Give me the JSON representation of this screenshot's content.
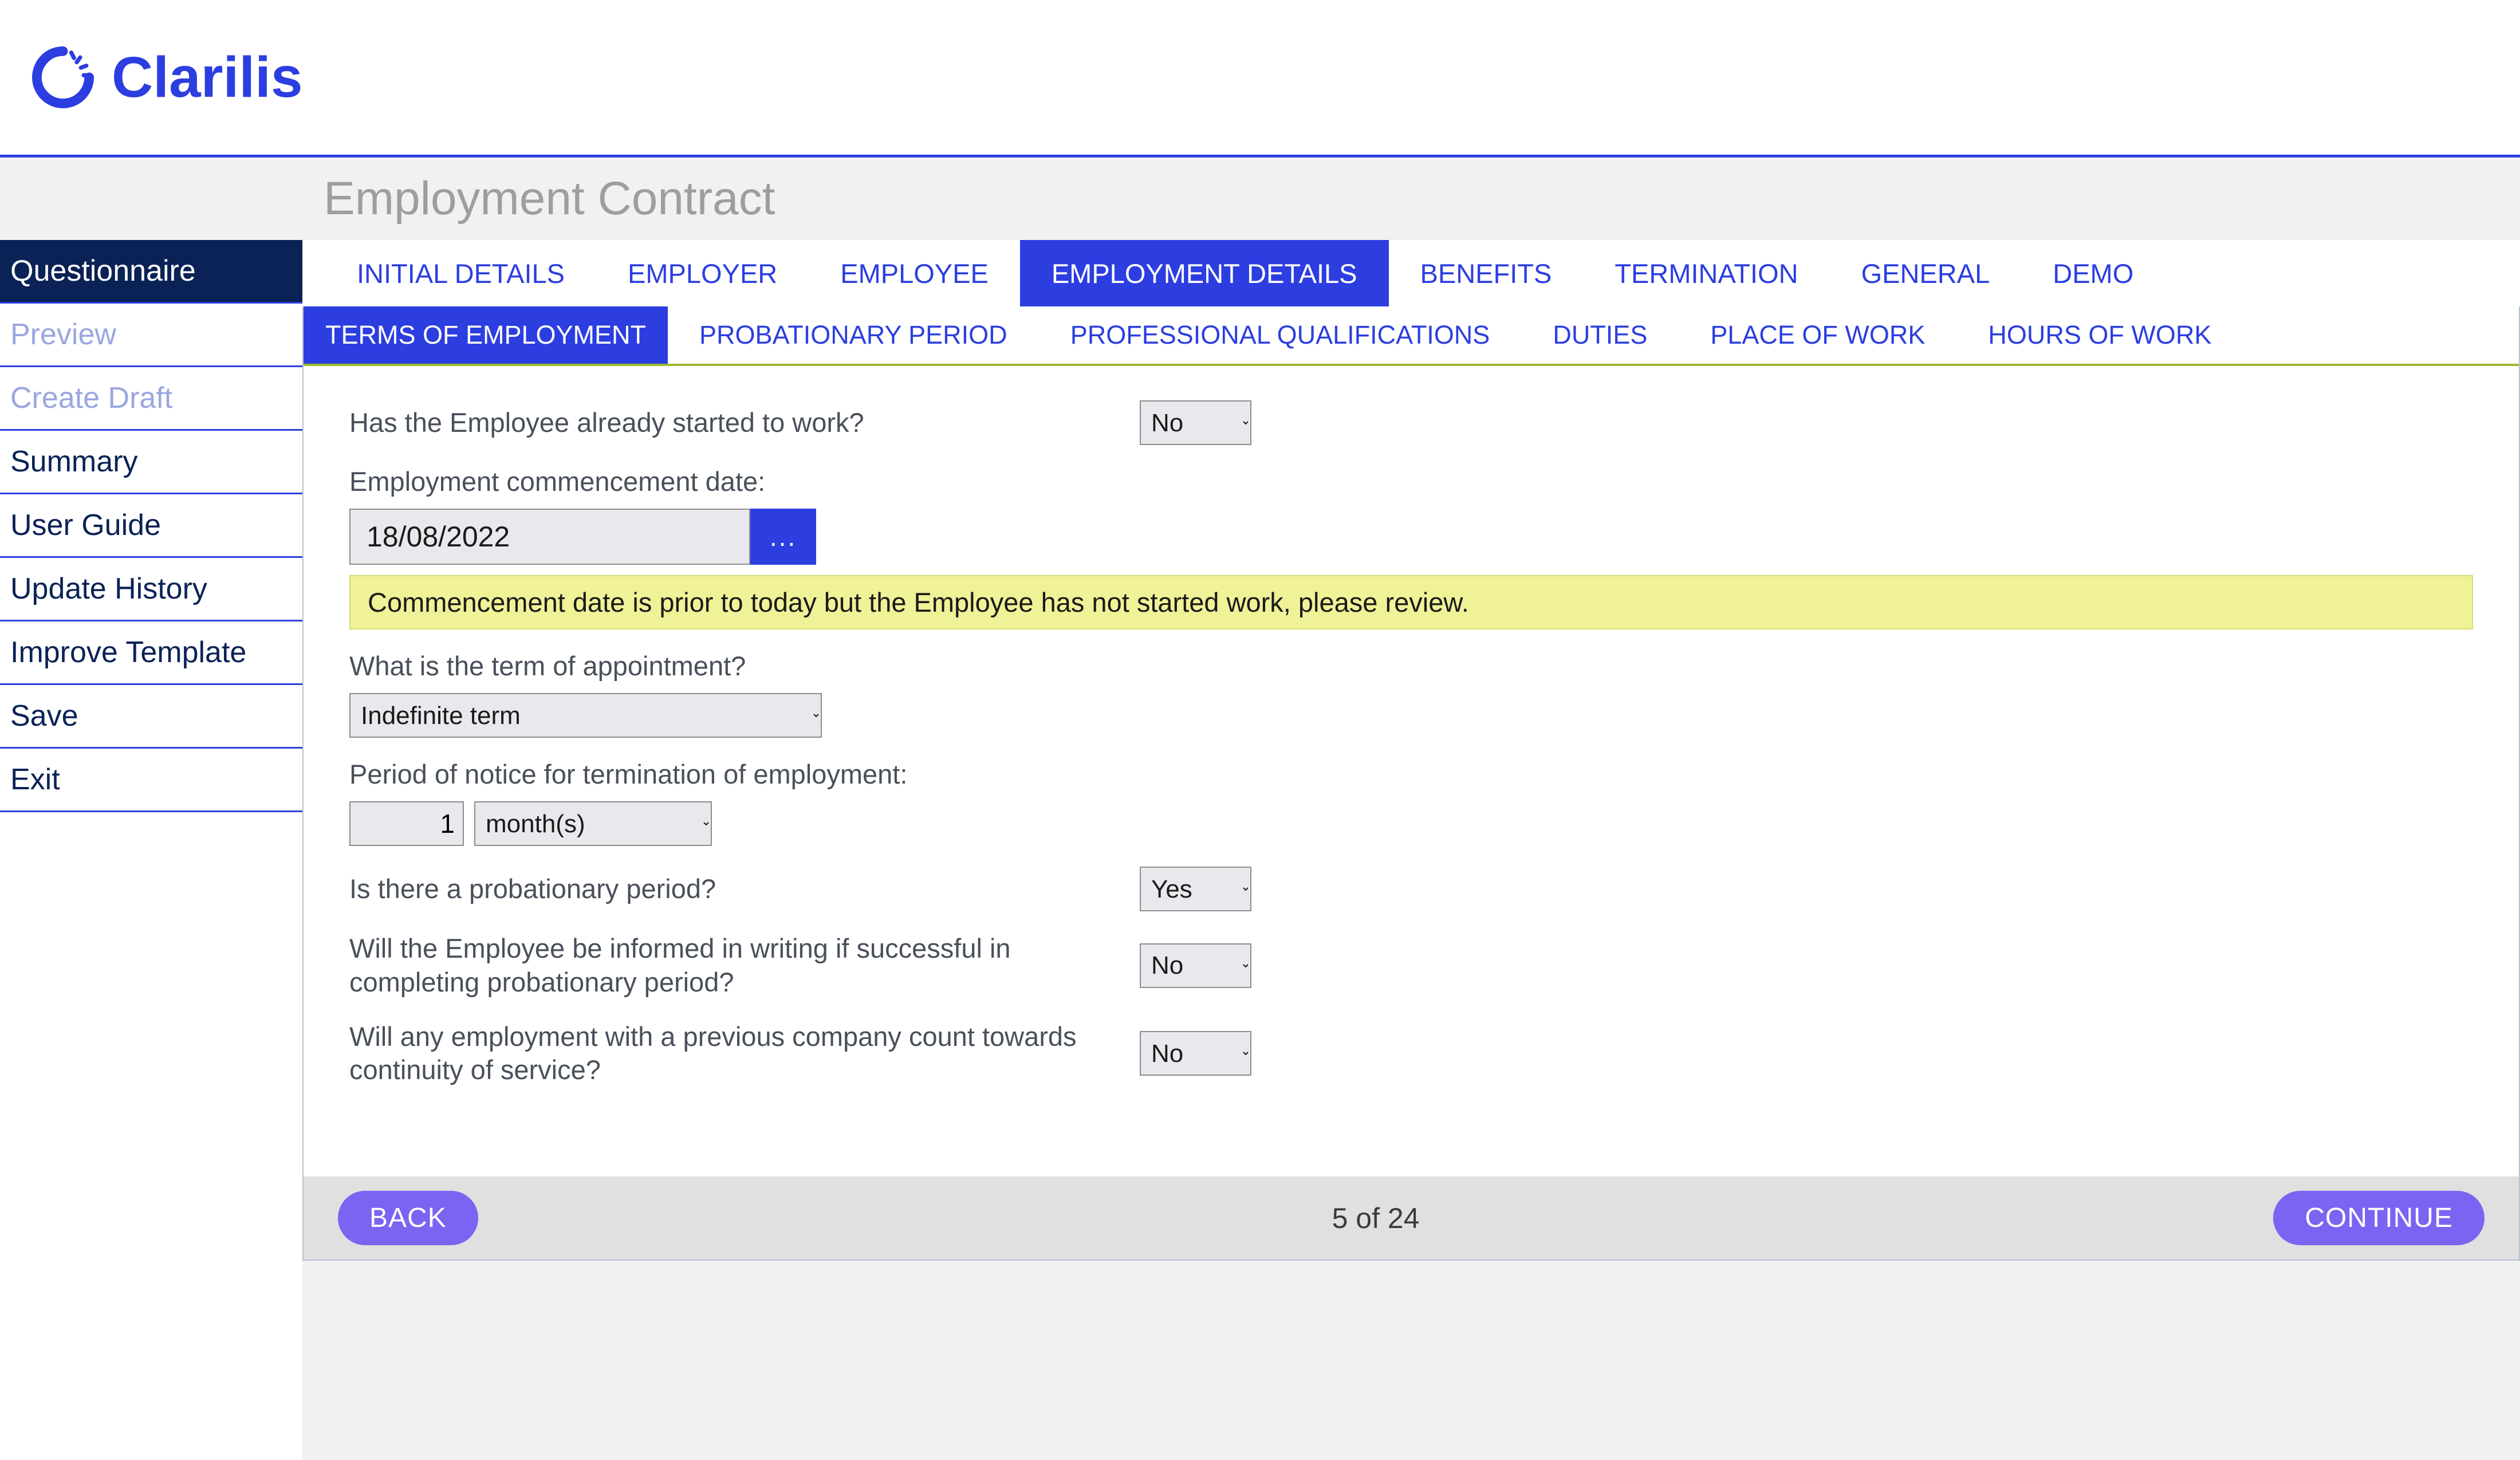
{
  "brand": {
    "name": "Clarilis"
  },
  "page_title": "Employment Contract",
  "sidebar": {
    "items": [
      {
        "label": "Questionnaire",
        "state": "active"
      },
      {
        "label": "Preview",
        "state": "faded"
      },
      {
        "label": "Create Draft",
        "state": "faded"
      },
      {
        "label": "Summary",
        "state": ""
      },
      {
        "label": "User Guide",
        "state": ""
      },
      {
        "label": "Update History",
        "state": ""
      },
      {
        "label": "Improve Template",
        "state": ""
      },
      {
        "label": "Save",
        "state": ""
      },
      {
        "label": "Exit",
        "state": ""
      }
    ]
  },
  "tabs_primary": [
    {
      "label": "INITIAL DETAILS",
      "active": false
    },
    {
      "label": "EMPLOYER",
      "active": false
    },
    {
      "label": "EMPLOYEE",
      "active": false
    },
    {
      "label": "EMPLOYMENT DETAILS",
      "active": true
    },
    {
      "label": "BENEFITS",
      "active": false
    },
    {
      "label": "TERMINATION",
      "active": false
    },
    {
      "label": "GENERAL",
      "active": false
    },
    {
      "label": "DEMO",
      "active": false
    }
  ],
  "tabs_secondary": [
    {
      "label": "TERMS OF EMPLOYMENT",
      "active": true
    },
    {
      "label": "PROBATIONARY PERIOD",
      "active": false
    },
    {
      "label": "PROFESSIONAL QUALIFICATIONS",
      "active": false
    },
    {
      "label": "DUTIES",
      "active": false
    },
    {
      "label": "PLACE OF WORK",
      "active": false
    },
    {
      "label": "HOURS OF WORK",
      "active": false
    }
  ],
  "form": {
    "q_started": {
      "label": "Has the Employee already started to work?",
      "value": "No"
    },
    "q_commence": {
      "label": "Employment commencement date:",
      "value": "18/08/2022",
      "picker_label": "..."
    },
    "warning": "Commencement date is prior to today but the Employee has not started work, please review.",
    "q_term": {
      "label": "What is the term of appointment?",
      "value": "Indefinite term"
    },
    "q_notice": {
      "label": "Period of notice for termination of employment:",
      "num": "1",
      "unit": "month(s)"
    },
    "q_probation": {
      "label": "Is there a probationary period?",
      "value": "Yes"
    },
    "q_inform_writing": {
      "label": "Will the Employee be informed in writing if successful in completing probationary period?",
      "value": "No"
    },
    "q_continuity": {
      "label": "Will any employment with a previous company count towards continuity of service?",
      "value": "No"
    }
  },
  "footer": {
    "back": "BACK",
    "continue": "CONTINUE",
    "pager": "5 of 24"
  }
}
